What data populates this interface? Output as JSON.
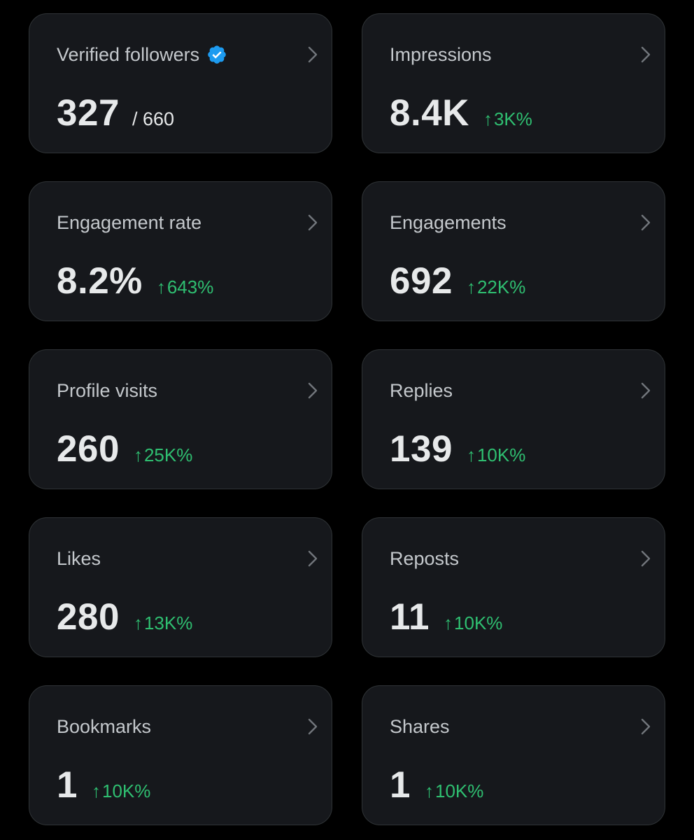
{
  "colors": {
    "background": "#000000",
    "card_background": "#16181c",
    "card_border": "#2f3336",
    "title_text": "#c4c8cc",
    "value_text": "#e7e9ea",
    "positive_change": "#2fbf71",
    "verified_badge": "#1d9bf0"
  },
  "cards": {
    "verified_followers": {
      "title": "Verified followers",
      "value": "327",
      "total": "/ 660",
      "icon": "verified-badge-icon"
    },
    "impressions": {
      "title": "Impressions",
      "value": "8.4K",
      "change_arrow": "↑",
      "change": "3K%"
    },
    "engagement_rate": {
      "title": "Engagement rate",
      "value": "8.2%",
      "change_arrow": "↑",
      "change": "643%"
    },
    "engagements": {
      "title": "Engagements",
      "value": "692",
      "change_arrow": "↑",
      "change": "22K%"
    },
    "profile_visits": {
      "title": "Profile visits",
      "value": "260",
      "change_arrow": "↑",
      "change": "25K%"
    },
    "replies": {
      "title": "Replies",
      "value": "139",
      "change_arrow": "↑",
      "change": "10K%"
    },
    "likes": {
      "title": "Likes",
      "value": "280",
      "change_arrow": "↑",
      "change": "13K%"
    },
    "reposts": {
      "title": "Reposts",
      "value": "11",
      "change_arrow": "↑",
      "change": "10K%"
    },
    "bookmarks": {
      "title": "Bookmarks",
      "value": "1",
      "change_arrow": "↑",
      "change": "10K%"
    },
    "shares": {
      "title": "Shares",
      "value": "1",
      "change_arrow": "↑",
      "change": "10K%"
    }
  }
}
